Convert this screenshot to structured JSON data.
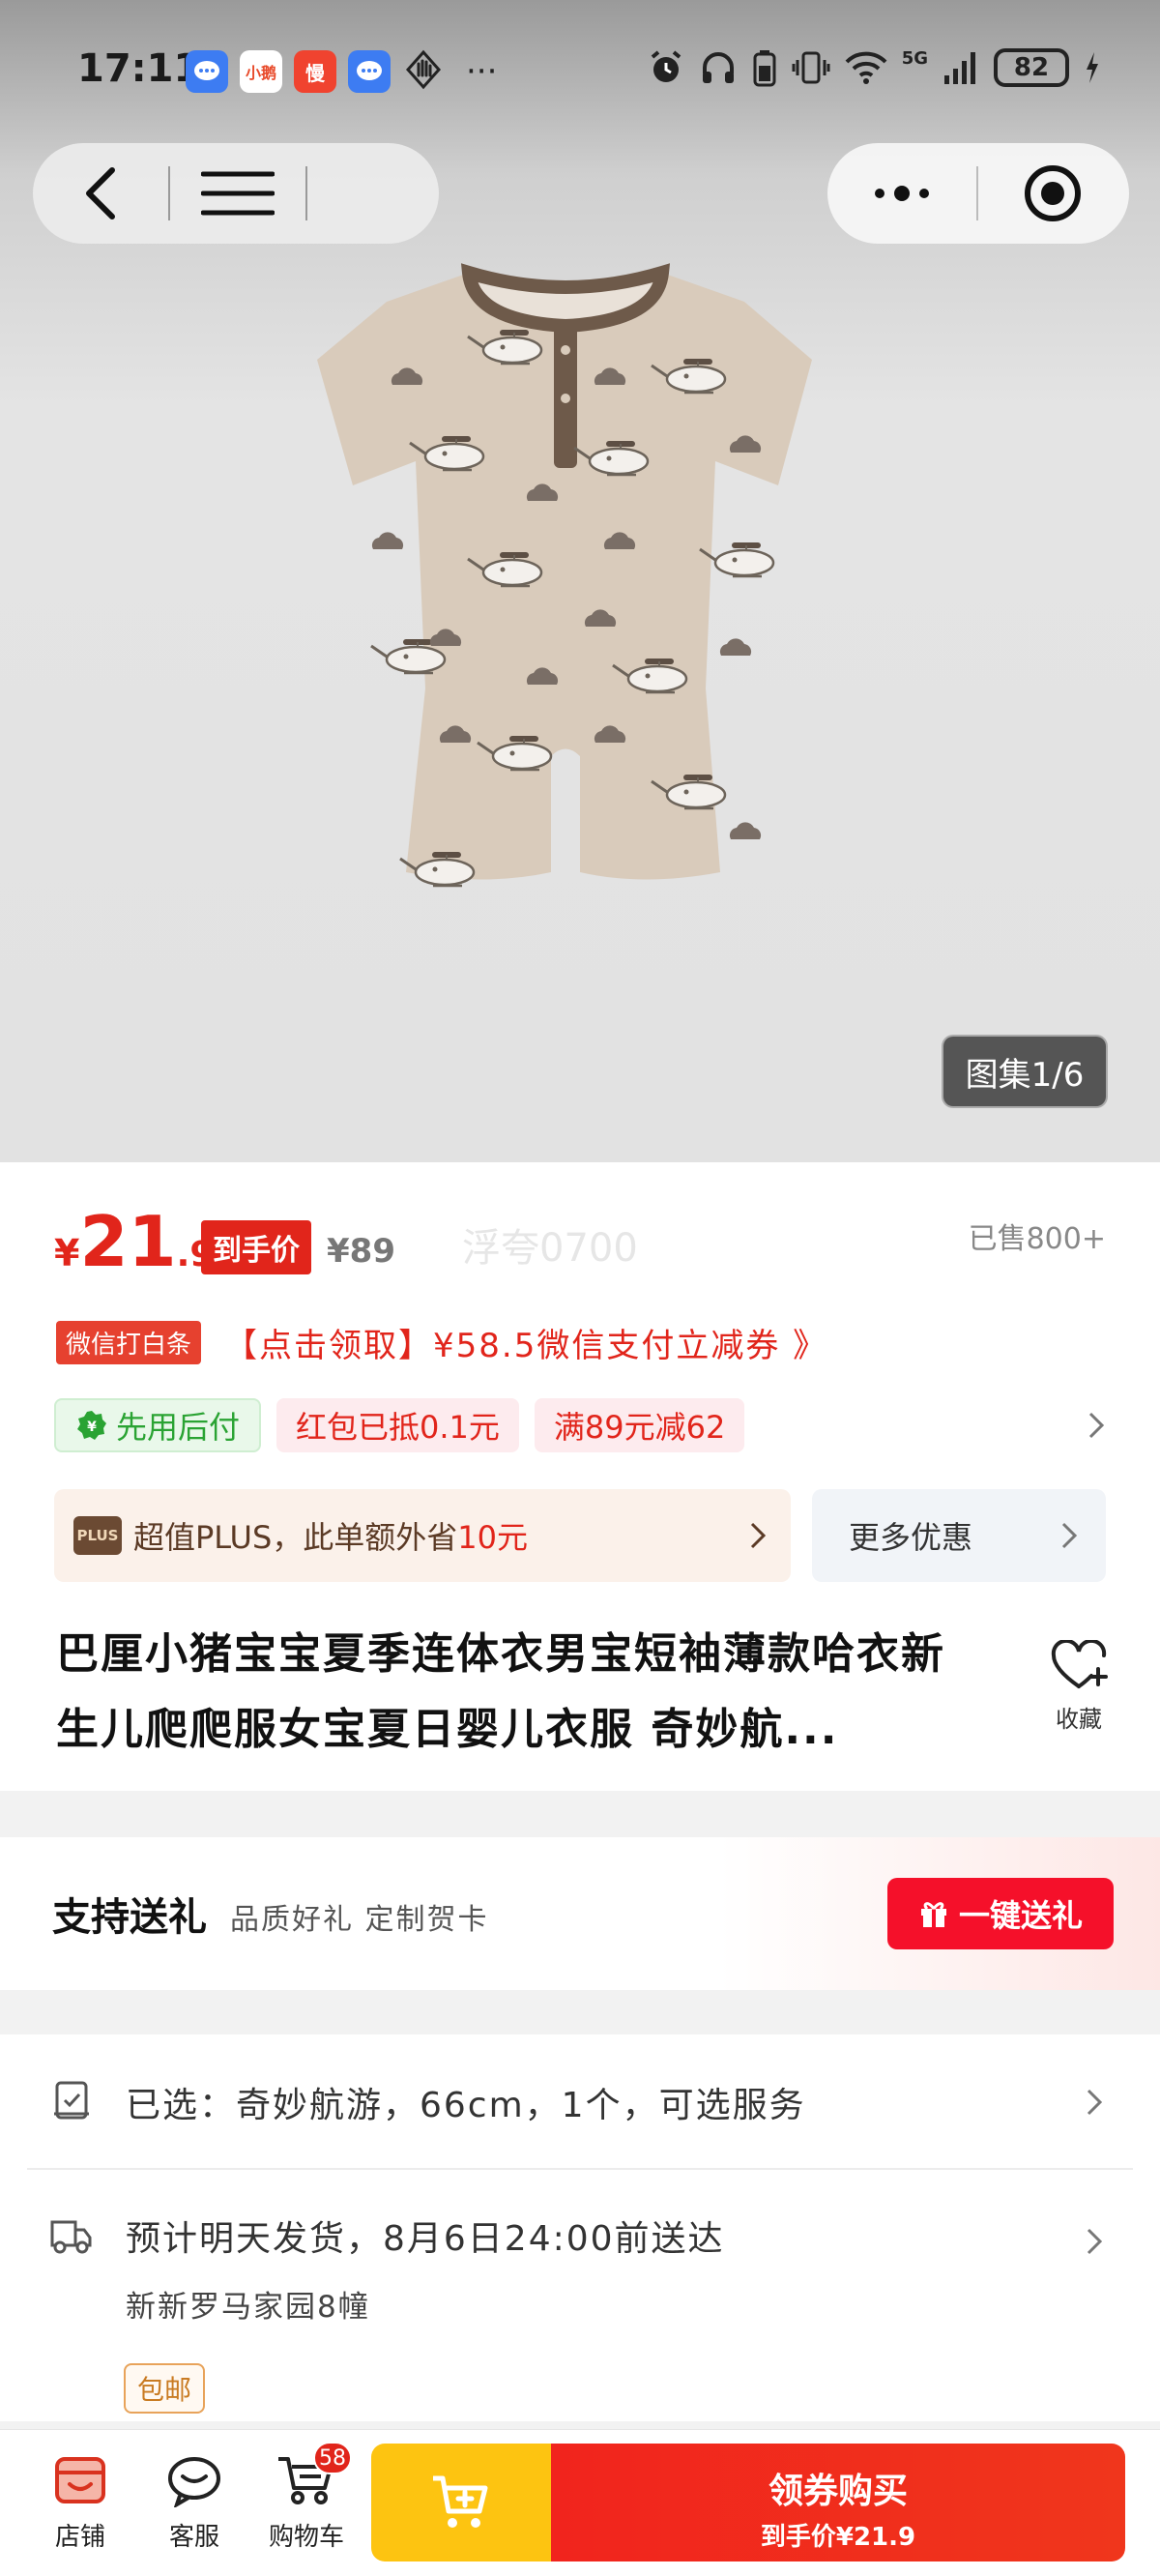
{
  "status_bar": {
    "time": "17:11",
    "app_icons": [
      {
        "icon": "chat-bubble-icon",
        "color": "#3d7cf2",
        "text": "•••"
      },
      {
        "icon": "xiaohongshu-icon",
        "color": "#ffffff",
        "text": "小鹅"
      },
      {
        "icon": "man-app-icon",
        "color": "#f0432f",
        "text": "慢"
      },
      {
        "icon": "chat-bubble-icon",
        "color": "#3d7cf2",
        "text": "•••"
      }
    ],
    "more": "···",
    "battery": "82",
    "network": "5G"
  },
  "gallery": {
    "counter": "图集1/6"
  },
  "price": {
    "symbol": "¥",
    "integer": "21",
    "decimal": ".9",
    "tag": "到手价",
    "original": "¥89",
    "watermark": "浮夸0700",
    "sold": "已售800+"
  },
  "coupon": {
    "tag": "微信打白条",
    "text": "【点击领取】¥58.5微信支付立减券 》"
  },
  "chips": [
    {
      "label": "先用后付",
      "style": "green"
    },
    {
      "label": "红包已抵0.1元",
      "style": "red"
    },
    {
      "label": "满89元减62",
      "style": "red"
    }
  ],
  "plus": {
    "badge": "PLUS",
    "text_prefix": "超值PLUS，此单额外省",
    "highlight": "10元"
  },
  "more_offers": "更多优惠",
  "product": {
    "title": "巴厘小猪宝宝夏季连体衣男宝短袖薄款哈衣新生儿爬爬服女宝夏日婴儿衣服 奇妙航...",
    "favorite_label": "收藏"
  },
  "gift": {
    "title": "支持送礼",
    "subtitle": "品质好礼 定制贺卡",
    "button": "一键送礼"
  },
  "spec": {
    "selected": "已选：奇妙航游，66cm，1个，可选服务",
    "delivery": "预计明天发货，8月6日24:00前送达",
    "address": "新新罗马家园8幢",
    "shipping_badge": "包邮"
  },
  "bottom_bar": {
    "tabs": [
      {
        "label": "店铺",
        "icon": "store-icon"
      },
      {
        "label": "客服",
        "icon": "customer-service-icon"
      },
      {
        "label": "购物车",
        "icon": "cart-icon"
      }
    ],
    "cart_count": "58",
    "buy_main": "领券购买",
    "buy_sub": "到手价¥21.9",
    "colors": {
      "accent_red": "#e1251b",
      "cart_yellow": "#fdc411"
    }
  }
}
